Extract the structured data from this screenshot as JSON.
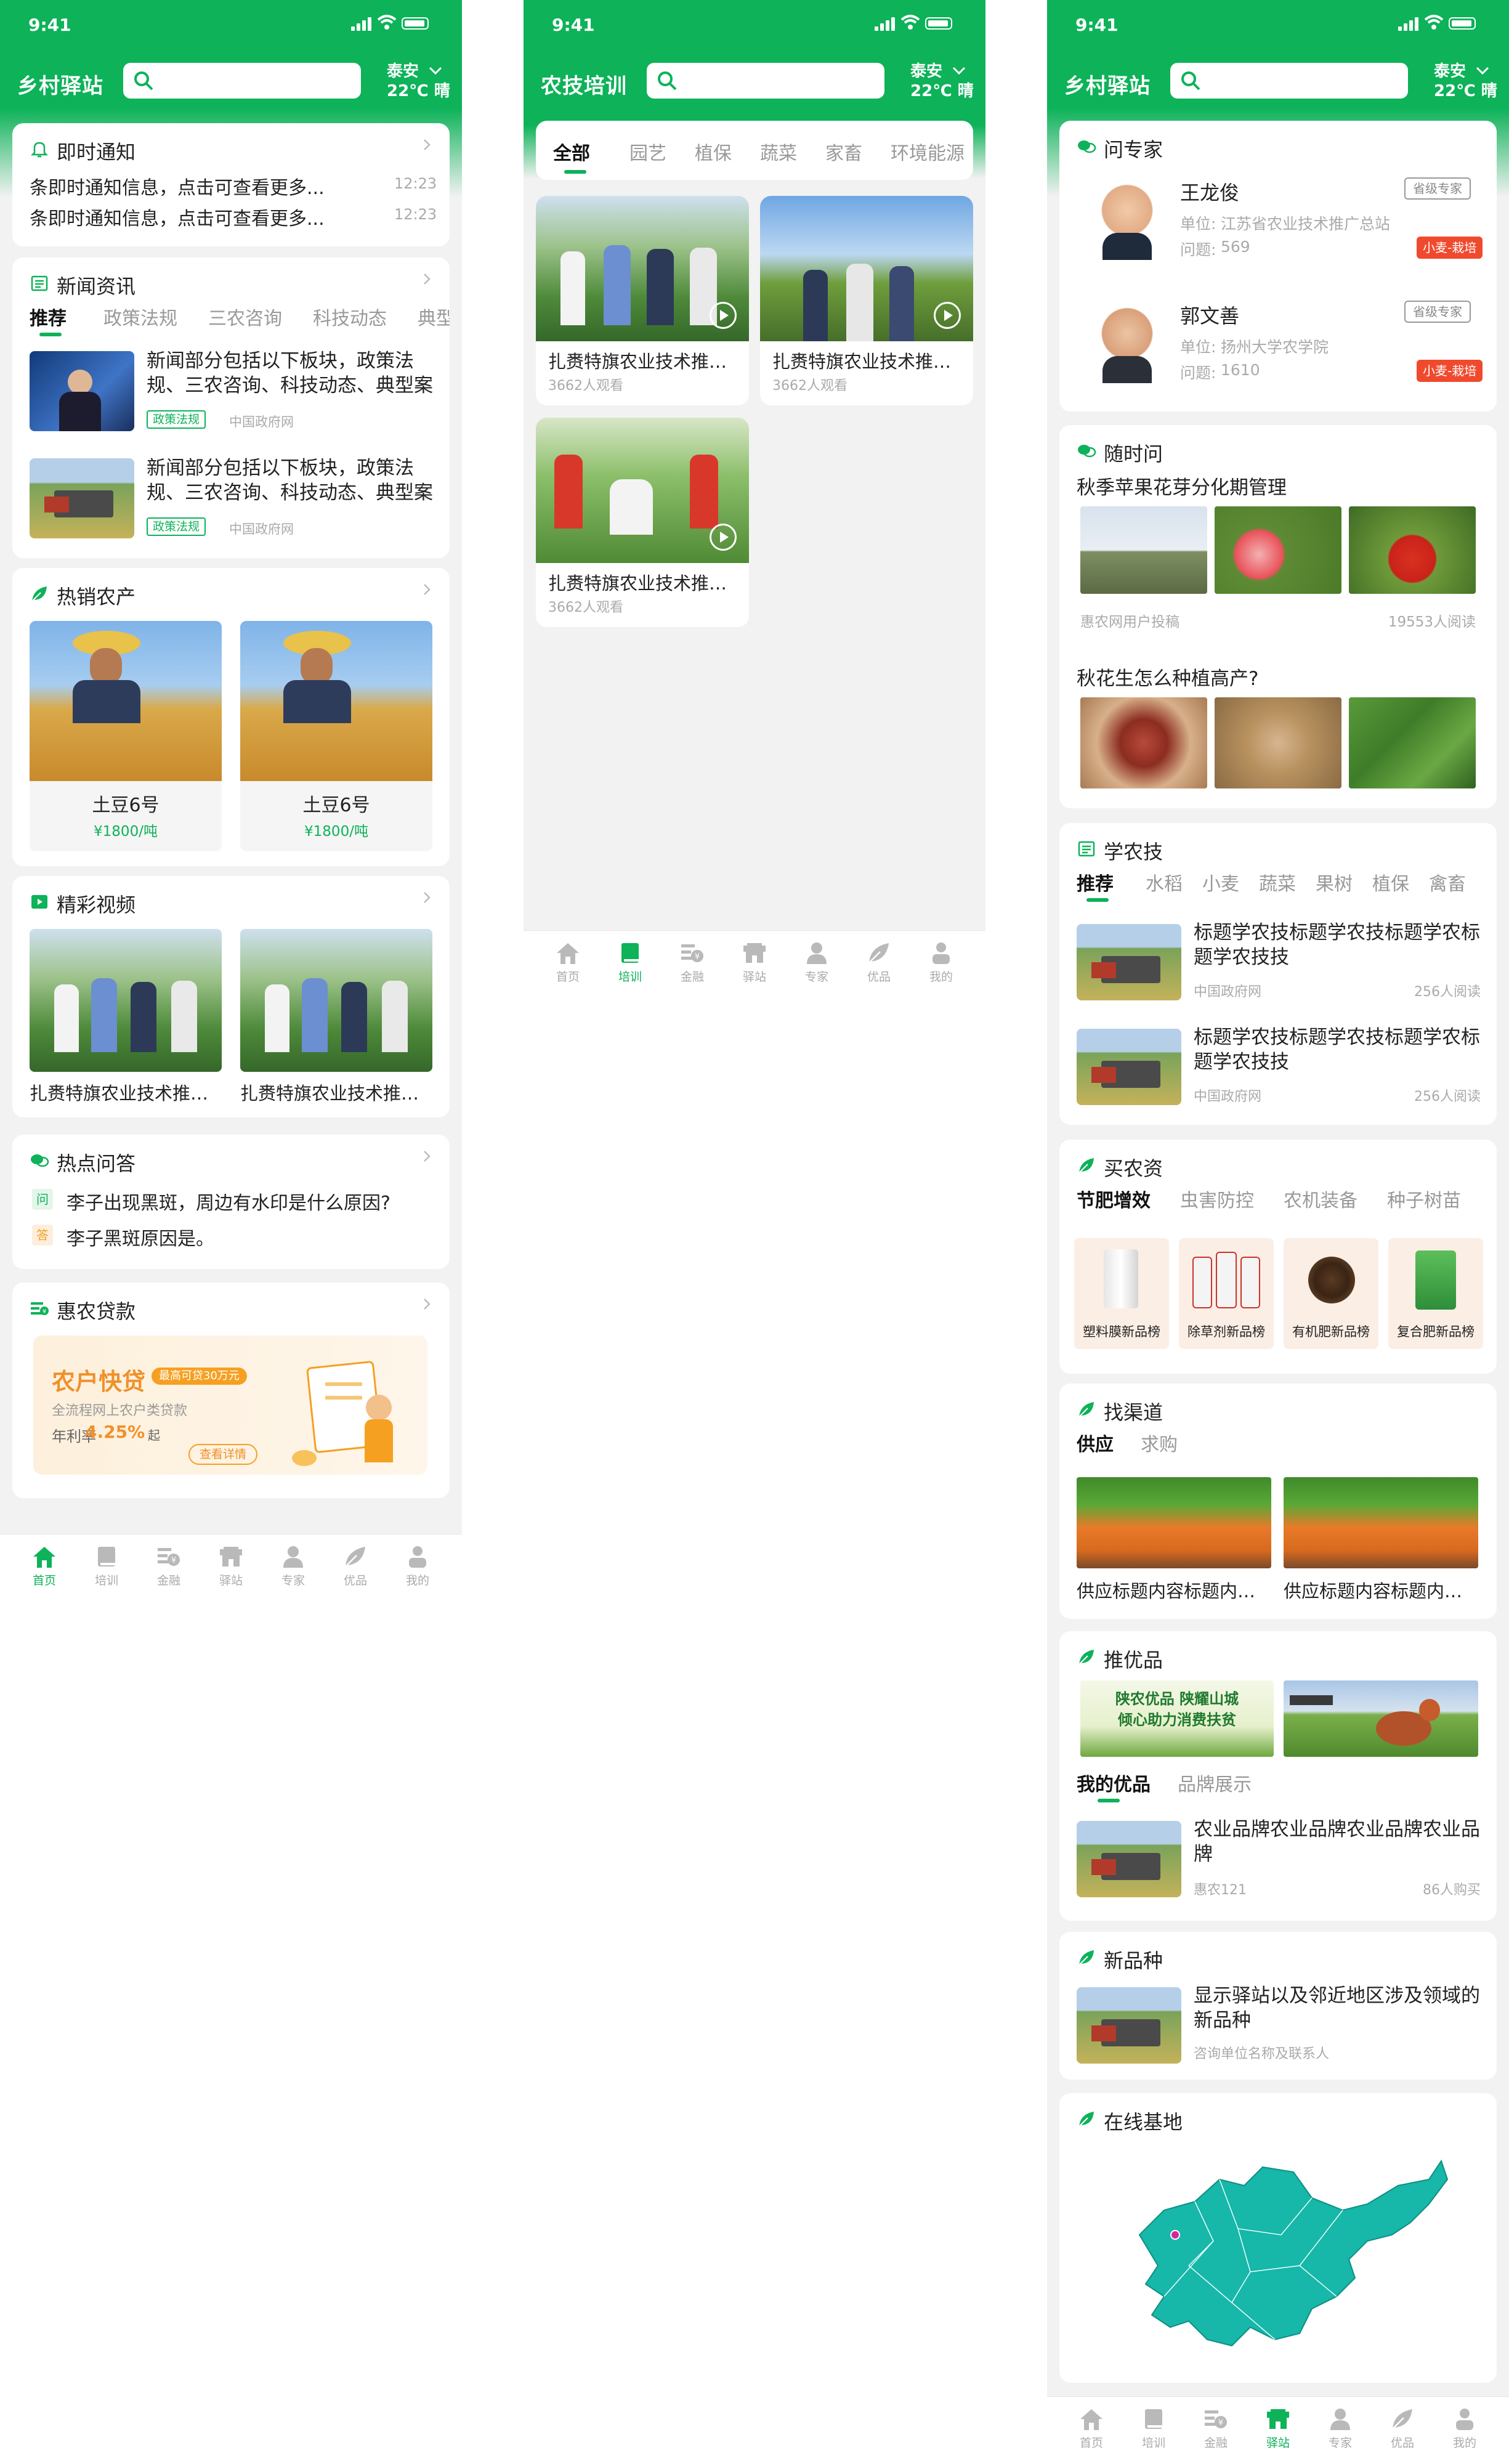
{
  "colors": {
    "brand": "#0db259",
    "accent_red": "#f04a2e",
    "loan_orange": "#f5a021"
  },
  "status_bar": {
    "time": "9:41"
  },
  "weather": {
    "city": "泰安",
    "condition": "22℃ 晴"
  },
  "nav": [
    {
      "label": "首页",
      "icon": "home-icon"
    },
    {
      "label": "培训",
      "icon": "book-icon"
    },
    {
      "label": "金融",
      "icon": "finance-icon"
    },
    {
      "label": "驿站",
      "icon": "station-icon"
    },
    {
      "label": "专家",
      "icon": "expert-icon"
    },
    {
      "label": "优品",
      "icon": "leaf-icon"
    },
    {
      "label": "我的",
      "icon": "person-icon"
    }
  ],
  "home": {
    "title": "乡村驿站",
    "notice": {
      "title": "即时通知",
      "items": [
        {
          "text": "条即时通知信息，点击可查看更多...",
          "time": "12:23"
        },
        {
          "text": "条即时通知信息，点击可查看更多...",
          "time": "12:23"
        }
      ]
    },
    "news": {
      "title": "新闻资讯",
      "tabs": [
        "推荐",
        "政策法规",
        "三农咨询",
        "科技动态",
        "典型"
      ],
      "items": [
        {
          "title": "新闻部分包括以下板块，政策法规、三农咨询、科技动态、典型案例",
          "tag": "政策法规",
          "source": "中国政府网"
        },
        {
          "title": "新闻部分包括以下板块，政策法规、三农咨询、科技动态、典型案例",
          "tag": "政策法规",
          "source": "中国政府网"
        }
      ]
    },
    "hot_products": {
      "title": "热销农产",
      "items": [
        {
          "name": "土豆6号",
          "price": "¥1800/吨"
        },
        {
          "name": "土豆6号",
          "price": "¥1800/吨"
        }
      ]
    },
    "videos": {
      "title": "精彩视频",
      "items": [
        {
          "title": "扎赉特旗农业技术推广中心"
        },
        {
          "title": "扎赉特旗农业技术推广中心"
        }
      ]
    },
    "qa": {
      "title": "热点问答",
      "q_mark": "问",
      "a_mark": "答",
      "question": "李子出现黑斑，周边有水印是什么原因?",
      "answer": "李子黑斑原因是。"
    },
    "loan": {
      "title": "惠农贷款",
      "name": "农户快贷",
      "limit": "最高可贷30万元",
      "desc": "全流程网上农户类贷款",
      "rate_label": "年利率",
      "rate": "4.25%",
      "rate_suffix": "起",
      "button": "查看详情"
    }
  },
  "training": {
    "title": "农技培训",
    "tabs": [
      "全部",
      "园艺",
      "植保",
      "蔬菜",
      "家畜",
      "环境能源"
    ],
    "videos": [
      {
        "title": "扎赉特旗农业技术推广中心",
        "views": "3662人观看"
      },
      {
        "title": "扎赉特旗农业技术推广中心",
        "views": "3662人观看"
      },
      {
        "title": "扎赉特旗农业技术推广中心",
        "views": "3662人观看"
      }
    ]
  },
  "station": {
    "title": "乡村驿站",
    "experts": {
      "title": "问专家",
      "items": [
        {
          "name": "王龙俊",
          "level": "省级专家",
          "unit_label": "单位:",
          "unit": "江苏省农业技术推广总站",
          "q_label": "问题:",
          "q_count": "569",
          "field": "小麦-栽培"
        },
        {
          "name": "郭文善",
          "level": "省级专家",
          "unit_label": "单位:",
          "unit": "扬州大学农学院",
          "q_label": "问题:",
          "q_count": "1610",
          "field": "小麦-栽培"
        }
      ]
    },
    "ask": {
      "title": "随时问",
      "posts": [
        {
          "title": "秋季苹果花芽分化期管理",
          "author": "惠农网用户投稿",
          "reads": "19553人阅读"
        },
        {
          "title": "秋花生怎么种植高产?"
        }
      ]
    },
    "learn": {
      "title": "学农技",
      "tabs": [
        "推荐",
        "水稻",
        "小麦",
        "蔬菜",
        "果树",
        "植保",
        "禽畜"
      ],
      "items": [
        {
          "title": "标题学农技标题学农技标题学农标题学农技技",
          "source": "中国政府网",
          "reads": "256人阅读"
        },
        {
          "title": "标题学农技标题学农技标题学农标题学农技技",
          "source": "中国政府网",
          "reads": "256人阅读"
        }
      ]
    },
    "supplies": {
      "title": "买农资",
      "tabs": [
        "节肥增效",
        "虫害防控",
        "农机装备",
        "种子树苗"
      ],
      "items": [
        {
          "label": "塑料膜新品榜"
        },
        {
          "label": "除草剂新品榜"
        },
        {
          "label": "有机肥新品榜"
        },
        {
          "label": "复合肥新品榜"
        }
      ]
    },
    "channel": {
      "title": "找渠道",
      "tabs": [
        "供应",
        "求购"
      ],
      "items": [
        {
          "title": "供应标题内容标题内容标题"
        },
        {
          "title": "供应标题内容标题内容标题"
        }
      ]
    },
    "picks": {
      "title": "推优品",
      "banner_text": [
        "陕农优品 陕耀山城",
        "倾心助力消费扶贫"
      ],
      "tabs": [
        "我的优品",
        "品牌展示"
      ],
      "item": {
        "title": "农业品牌农业品牌农业品牌农业品牌",
        "source": "惠农121",
        "buys": "86人购买"
      }
    },
    "new_variety": {
      "title": "新品种",
      "item": {
        "title": "显示驿站以及邻近地区涉及领域的新品种",
        "sub": "咨询单位名称及联系人"
      }
    },
    "base": {
      "title": "在线基地"
    }
  }
}
